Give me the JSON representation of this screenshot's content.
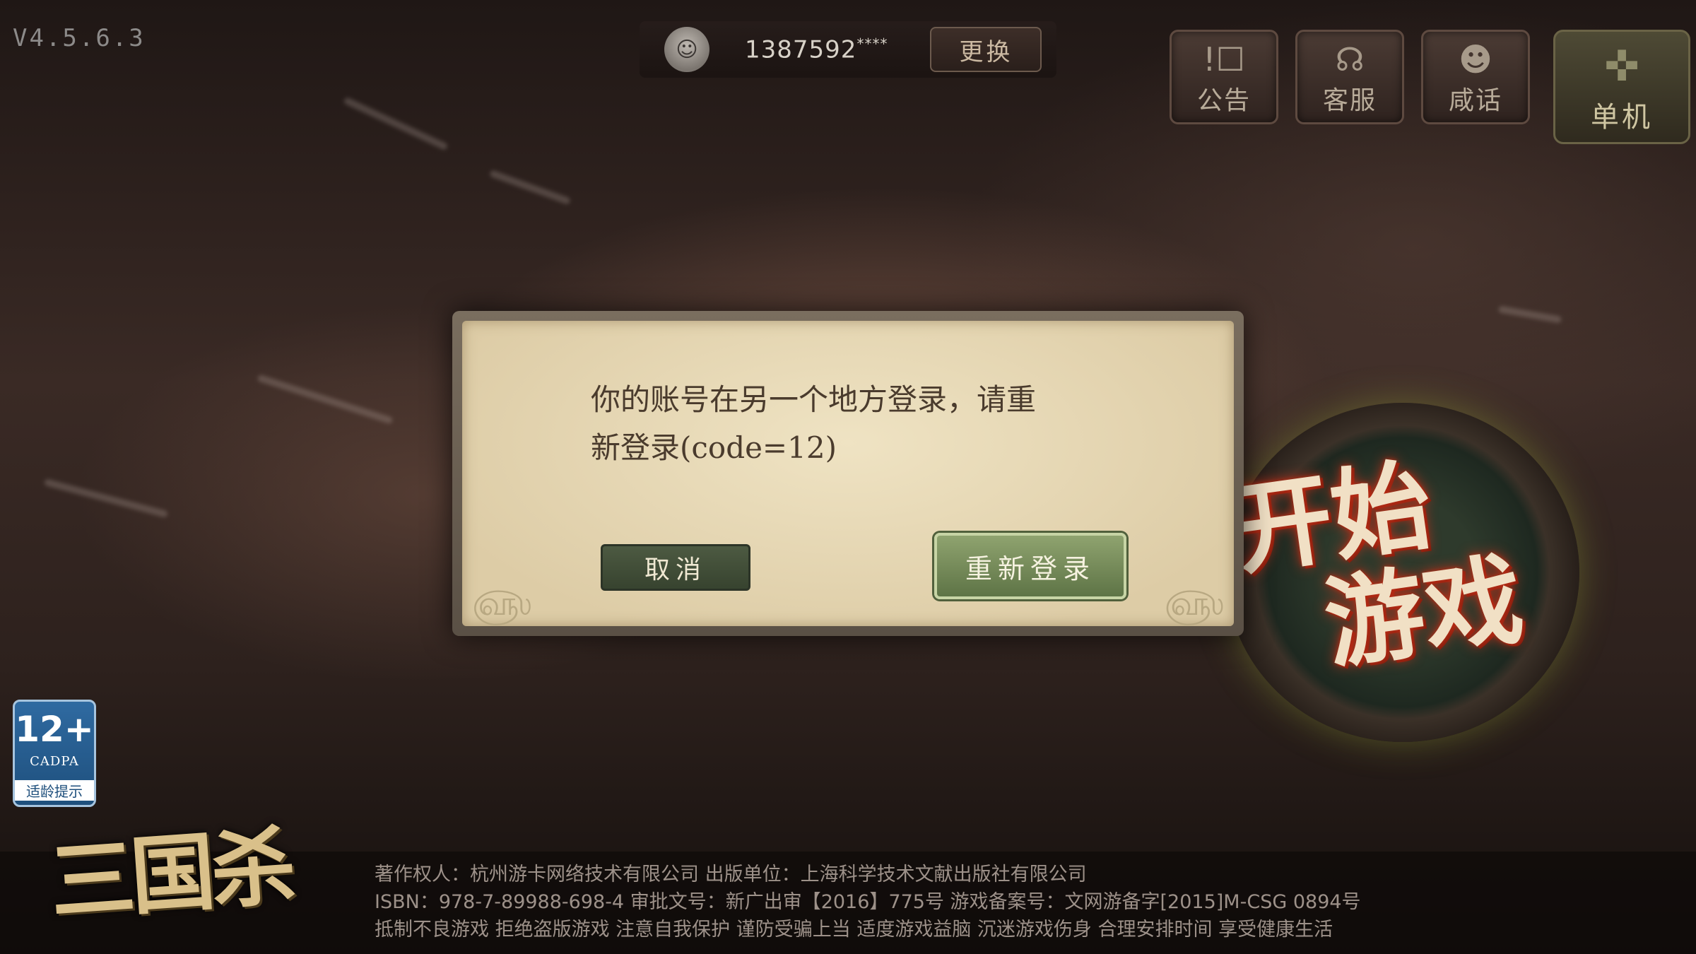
{
  "version": "V4.5.6.3",
  "account": {
    "id": "1387592",
    "masked_suffix": "****",
    "switch_label": "更换"
  },
  "top_buttons": [
    {
      "label": "公告",
      "icon": "notice-icon"
    },
    {
      "label": "客服",
      "icon": "customer-service-icon"
    },
    {
      "label": "咸话",
      "icon": "chat-icon"
    }
  ],
  "single_player": {
    "label": "单机",
    "icon": "gamepad-icon"
  },
  "dialog": {
    "message_line1": "你的账号在另一个地方登录，请重",
    "message_line2": "新登录(code=12)",
    "cancel_label": "取消",
    "relogin_label": "重新登录"
  },
  "start_game": {
    "label_line1": "开始",
    "label_line2": "游戏"
  },
  "age_rating": {
    "number": "12+",
    "org": "CADPA",
    "tip": "适龄提示"
  },
  "logo_text": "三国杀",
  "footer": {
    "line1": "著作权人：杭州游卡网络技术有限公司  出版单位：上海科学技术文献出版社有限公司",
    "line2": "ISBN：978-7-89988-698-4  审批文号：新广出审【2016】775号  游戏备案号：文网游备字[2015]M-CSG 0894号",
    "line3": "抵制不良游戏 拒绝盗版游戏 注意自我保护 谨防受骗上当 适度游戏益脑 沉迷游戏伤身 合理安排时间 享受健康生活"
  }
}
